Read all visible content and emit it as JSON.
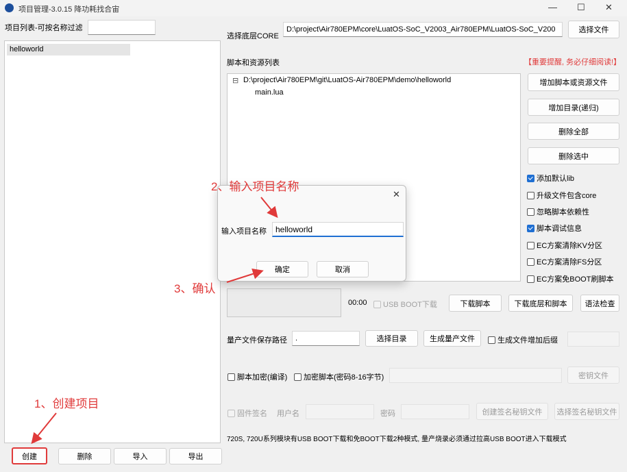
{
  "window": {
    "title": "项目管理-3.0.15 降功耗找合宙",
    "controls": [
      "—",
      "☐",
      "✕"
    ]
  },
  "left": {
    "filter_label": "项目列表-可按名称过滤",
    "filter_value": "",
    "projects": [
      "helloworld"
    ],
    "buttons": {
      "create": "创建",
      "delete": "删除",
      "import": "导入",
      "export": "导出"
    }
  },
  "core": {
    "label": "选择底层CORE",
    "path": "D:\\project\\Air780EPM\\core\\LuatOS-SoC_V2003_Air780EPM\\LuatOS-SoC_V200",
    "select_button": "选择文件"
  },
  "scripts": {
    "label": "脚本和资源列表",
    "notice": "【重要提醒, 务必仔细阅读!】",
    "tree_root": "D:\\project\\Air780EPM\\git\\LuatOS-Air780EPM\\demo\\helloworld",
    "tree_child": "main.lua",
    "tree_toggle": "⊟",
    "buttons": {
      "add_file": "增加脚本或资源文件",
      "add_dir": "增加目录(递归)",
      "delete_all": "删除全部",
      "delete_selected": "删除选中"
    },
    "options": [
      {
        "label": "添加默认lib",
        "checked": true
      },
      {
        "label": "升级文件包含core",
        "checked": false
      },
      {
        "label": "忽略脚本依赖性",
        "checked": false
      },
      {
        "label": "脚本调试信息",
        "checked": true
      },
      {
        "label": "EC方案清除KV分区",
        "checked": false
      },
      {
        "label": "EC方案清除FS分区",
        "checked": false
      },
      {
        "label": "EC方案免BOOT刷脚本",
        "checked": false
      }
    ]
  },
  "download": {
    "time": "00:00",
    "usb_boot": "USB BOOT下载",
    "download_script": "下载脚本",
    "download_core_script": "下载底层和脚本",
    "syntax_check": "语法检查"
  },
  "production": {
    "path_label": "量产文件保存路径",
    "path_value": ".",
    "select_dir": "选择目录",
    "generate": "生成量产文件",
    "suffix_option": "生成文件增加后缀"
  },
  "encrypt": {
    "script_encrypt": "脚本加密(编译)",
    "encrypt_password": "加密脚本(密码8-16字节)",
    "key_file": "密钥文件"
  },
  "signing": {
    "firmware_sign": "固件签名",
    "username": "用户名",
    "password": "密码",
    "create_key": "创建签名秘钥文件",
    "select_key": "选择签名秘钥文件"
  },
  "footer_note": "720S, 720U系列模块有USB BOOT下载和免BOOT下载2种模式, 量产烧录必须通过拉高USB BOOT进入下载模式",
  "dialog": {
    "field_label": "输入项目名称",
    "field_value": "helloworld",
    "ok": "确定",
    "cancel": "取消",
    "close": "✕"
  },
  "annotations": {
    "step1": "1、创建项目",
    "step2": "2、输入项目名称",
    "step3": "3、确认"
  },
  "colors": {
    "accent": "#1f6fd2",
    "annotation": "#e03a3a",
    "notice": "#e03a3a"
  }
}
